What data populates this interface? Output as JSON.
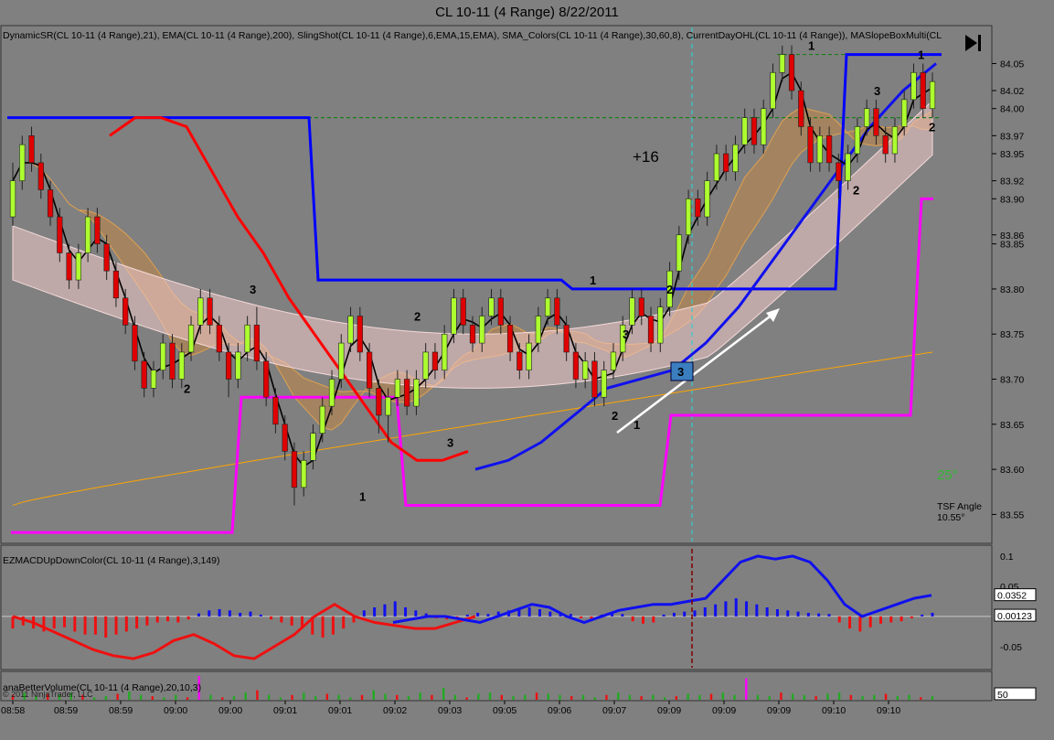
{
  "window": {
    "title": "CL 10-11 (4 Range)  8/22/2011"
  },
  "panels": {
    "price": {
      "indicators_label": "DynamicSR(CL 10-11 (4 Range),21), EMA(CL 10-11 (4 Range),200), SlingShot(CL 10-11 (4 Range),6,EMA,15,EMA), SMA_Colors(CL 10-11 (4 Range),30,60,8), CurrentDayOHL(CL 10-11 (4 Range)), MASlopeBoxMulti(CL",
      "trade_result": "+16",
      "angle_value": "25°",
      "tsf_label": "TSF Angle",
      "tsf_value": "10.55°",
      "box_label": "3"
    },
    "macd": {
      "label": "EZMACDUpDownColor(CL 10-11 (4 Range),3,149)",
      "value1": "0.0352",
      "value2": "0.00123"
    },
    "volume": {
      "label": "anaBetterVolume(CL 10-11 (4 Range),20,10,3)",
      "value": "50",
      "copyright": "© 2011 NinjaTrader, LLC"
    }
  },
  "colors": {
    "background": "#808080",
    "up_bar": "#adff2f",
    "down_bar": "#e00000",
    "ema200": "#ffa500",
    "support_line": "#0000ff",
    "ohl_line": "#ff00ff",
    "slingshot_red": "#ff0000"
  },
  "chart_data": {
    "type": "candlestick",
    "symbol": "CL 10-11 (4 Range)",
    "date": "8/22/2011",
    "ylim": [
      83.52,
      84.09
    ],
    "y_ticks": [
      84.05,
      84.02,
      84.0,
      83.97,
      83.95,
      83.92,
      83.9,
      83.86,
      83.85,
      83.8,
      83.75,
      83.7,
      83.65,
      83.6,
      83.55
    ],
    "x_ticks": [
      "08:58",
      "08:59",
      "08:59",
      "09:00",
      "09:00",
      "09:01",
      "09:01",
      "09:02",
      "09:03",
      "09:05",
      "09:06",
      "09:07",
      "09:09",
      "09:09",
      "09:09",
      "09:10",
      "09:10"
    ],
    "candles": [
      [
        83.88,
        83.92,
        83.94,
        83.87
      ],
      [
        83.92,
        83.96,
        83.97,
        83.91
      ],
      [
        83.97,
        83.94,
        83.98,
        83.93
      ],
      [
        83.94,
        83.91,
        83.95,
        83.9
      ],
      [
        83.91,
        83.88,
        83.92,
        83.87
      ],
      [
        83.88,
        83.84,
        83.89,
        83.83
      ],
      [
        83.84,
        83.81,
        83.85,
        83.8
      ],
      [
        83.81,
        83.84,
        83.85,
        83.8
      ],
      [
        83.84,
        83.88,
        83.89,
        83.83
      ],
      [
        83.88,
        83.85,
        83.89,
        83.84
      ],
      [
        83.85,
        83.82,
        83.86,
        83.81
      ],
      [
        83.82,
        83.79,
        83.83,
        83.78
      ],
      [
        83.79,
        83.76,
        83.8,
        83.75
      ],
      [
        83.76,
        83.72,
        83.77,
        83.71
      ],
      [
        83.72,
        83.69,
        83.73,
        83.68
      ],
      [
        83.69,
        83.71,
        83.72,
        83.68
      ],
      [
        83.71,
        83.74,
        83.75,
        83.7
      ],
      [
        83.74,
        83.7,
        83.75,
        83.69
      ],
      [
        83.7,
        83.73,
        83.74,
        83.69
      ],
      [
        83.73,
        83.76,
        83.77,
        83.72
      ],
      [
        83.76,
        83.79,
        83.8,
        83.75
      ],
      [
        83.79,
        83.76,
        83.8,
        83.75
      ],
      [
        83.76,
        83.73,
        83.77,
        83.72
      ],
      [
        83.73,
        83.7,
        83.74,
        83.68
      ],
      [
        83.7,
        83.73,
        83.74,
        83.69
      ],
      [
        83.73,
        83.76,
        83.77,
        83.72
      ],
      [
        83.76,
        83.72,
        83.78,
        83.71
      ],
      [
        83.72,
        83.68,
        83.73,
        83.67
      ],
      [
        83.68,
        83.65,
        83.69,
        83.64
      ],
      [
        83.65,
        83.62,
        83.66,
        83.61
      ],
      [
        83.62,
        83.58,
        83.63,
        83.56
      ],
      [
        83.58,
        83.61,
        83.62,
        83.57
      ],
      [
        83.61,
        83.64,
        83.65,
        83.6
      ],
      [
        83.64,
        83.67,
        83.68,
        83.63
      ],
      [
        83.67,
        83.7,
        83.71,
        83.66
      ],
      [
        83.7,
        83.74,
        83.75,
        83.69
      ],
      [
        83.74,
        83.77,
        83.78,
        83.73
      ],
      [
        83.77,
        83.73,
        83.78,
        83.72
      ],
      [
        83.73,
        83.69,
        83.74,
        83.68
      ],
      [
        83.69,
        83.66,
        83.7,
        83.64
      ],
      [
        83.66,
        83.68,
        83.69,
        83.63
      ],
      [
        83.68,
        83.7,
        83.71,
        83.67
      ],
      [
        83.7,
        83.67,
        83.71,
        83.66
      ],
      [
        83.67,
        83.7,
        83.71,
        83.66
      ],
      [
        83.7,
        83.73,
        83.74,
        83.69
      ],
      [
        83.73,
        83.71,
        83.74,
        83.7
      ],
      [
        83.71,
        83.75,
        83.76,
        83.7
      ],
      [
        83.75,
        83.79,
        83.8,
        83.74
      ],
      [
        83.79,
        83.76,
        83.8,
        83.75
      ],
      [
        83.76,
        83.74,
        83.77,
        83.73
      ],
      [
        83.74,
        83.77,
        83.78,
        83.73
      ],
      [
        83.77,
        83.79,
        83.8,
        83.76
      ],
      [
        83.79,
        83.76,
        83.8,
        83.75
      ],
      [
        83.76,
        83.73,
        83.77,
        83.72
      ],
      [
        83.73,
        83.71,
        83.74,
        83.7
      ],
      [
        83.71,
        83.74,
        83.75,
        83.7
      ],
      [
        83.74,
        83.77,
        83.78,
        83.73
      ],
      [
        83.77,
        83.79,
        83.8,
        83.76
      ],
      [
        83.79,
        83.76,
        83.8,
        83.75
      ],
      [
        83.76,
        83.73,
        83.77,
        83.72
      ],
      [
        83.73,
        83.7,
        83.74,
        83.69
      ],
      [
        83.7,
        83.72,
        83.73,
        83.69
      ],
      [
        83.72,
        83.68,
        83.73,
        83.67
      ],
      [
        83.68,
        83.71,
        83.72,
        83.67
      ],
      [
        83.71,
        83.73,
        83.74,
        83.7
      ],
      [
        83.73,
        83.76,
        83.77,
        83.72
      ],
      [
        83.76,
        83.79,
        83.8,
        83.75
      ],
      [
        83.79,
        83.77,
        83.8,
        83.76
      ],
      [
        83.77,
        83.74,
        83.78,
        83.73
      ],
      [
        83.74,
        83.78,
        83.79,
        83.73
      ],
      [
        83.78,
        83.82,
        83.83,
        83.77
      ],
      [
        83.82,
        83.86,
        83.87,
        83.81
      ],
      [
        83.86,
        83.9,
        83.91,
        83.85
      ],
      [
        83.9,
        83.88,
        83.91,
        83.87
      ],
      [
        83.88,
        83.92,
        83.93,
        83.87
      ],
      [
        83.92,
        83.95,
        83.96,
        83.91
      ],
      [
        83.95,
        83.93,
        83.96,
        83.92
      ],
      [
        83.93,
        83.96,
        83.97,
        83.92
      ],
      [
        83.96,
        83.99,
        84.0,
        83.95
      ],
      [
        83.99,
        83.96,
        84.0,
        83.95
      ],
      [
        83.96,
        84.0,
        84.01,
        83.95
      ],
      [
        84.0,
        84.04,
        84.05,
        83.99
      ],
      [
        84.04,
        84.06,
        84.07,
        84.03
      ],
      [
        84.06,
        84.02,
        84.07,
        84.01
      ],
      [
        84.02,
        83.98,
        84.03,
        83.97
      ],
      [
        83.98,
        83.94,
        83.99,
        83.93
      ],
      [
        83.94,
        83.97,
        83.98,
        83.93
      ],
      [
        83.97,
        83.94,
        83.98,
        83.93
      ],
      [
        83.94,
        83.92,
        83.95,
        83.9
      ],
      [
        83.92,
        83.95,
        83.96,
        83.91
      ],
      [
        83.95,
        83.98,
        83.99,
        83.94
      ],
      [
        83.98,
        84.0,
        84.01,
        83.97
      ],
      [
        84.0,
        83.97,
        84.01,
        83.96
      ],
      [
        83.97,
        83.95,
        83.98,
        83.94
      ],
      [
        83.95,
        83.98,
        83.99,
        83.94
      ],
      [
        83.98,
        84.01,
        84.02,
        83.97
      ],
      [
        84.01,
        84.04,
        84.05,
        84.0
      ],
      [
        84.04,
        84.0,
        84.05,
        83.99
      ],
      [
        84.0,
        84.03,
        84.04,
        83.99
      ]
    ],
    "candle_fields": [
      "open",
      "close",
      "high",
      "low"
    ],
    "annotations": [
      {
        "text": "1",
        "value": 84.07
      },
      {
        "text": "2",
        "value": 83.69
      },
      {
        "text": "3",
        "value": 83.8
      },
      {
        "text": "2",
        "value": 83.77
      },
      {
        "text": "1",
        "value": 83.57
      },
      {
        "text": "3",
        "value": 83.63
      },
      {
        "text": "1",
        "value": 83.81
      },
      {
        "text": "2",
        "value": 83.8
      },
      {
        "text": "3",
        "value": 83.75
      },
      {
        "text": "2",
        "value": 83.66
      },
      {
        "text": "1",
        "value": 83.65
      },
      {
        "text": "3",
        "value": 84.02
      },
      {
        "text": "2",
        "value": 83.91
      },
      {
        "text": "1",
        "value": 84.06
      },
      {
        "text": "2",
        "value": 83.98
      }
    ],
    "lines": {
      "current_day_high": 84.06,
      "dynamic_sr_start": 83.99,
      "dynamic_sr_mid": 83.81,
      "dynamic_sr_end": 83.8,
      "ohl_low": 83.53,
      "ohl_mid1": 83.68,
      "ohl_mid2": 83.56,
      "ohl_mid3": 83.66,
      "ohl_end": 83.9,
      "prior_level": 83.99
    },
    "macd": {
      "ylim": [
        -0.085,
        0.115
      ],
      "ticks": [
        "0.1",
        "0.05",
        "-0.05"
      ],
      "histogram": [
        -0.02,
        -0.015,
        -0.02,
        -0.025,
        -0.02,
        -0.018,
        -0.025,
        -0.03,
        -0.03,
        -0.035,
        -0.03,
        -0.025,
        -0.02,
        -0.015,
        -0.01,
        -0.008,
        -0.01,
        -0.005,
        0.005,
        0.01,
        0.012,
        0.01,
        0.006,
        0.008,
        0.003,
        -0.005,
        -0.01,
        -0.015,
        -0.02,
        -0.03,
        -0.035,
        -0.03,
        -0.02,
        -0.01,
        0.01,
        0.015,
        0.02,
        0.025,
        0.015,
        0.01,
        0.005,
        -0.003,
        -0.005,
        -0.004,
        0.003,
        0.006,
        0.004,
        0.008,
        0.01,
        0.012,
        0.015,
        0.012,
        0.008,
        0.005,
        0.004,
        -0.003,
        -0.005,
        0.003,
        0.006,
        0.004,
        -0.008,
        -0.012,
        -0.01,
        0.003,
        0.006,
        0.008,
        0.01,
        0.015,
        0.02,
        0.025,
        0.03,
        0.025,
        0.02,
        0.015,
        0.012,
        0.01,
        0.008,
        0.006,
        0.005,
        0.004,
        -0.01,
        -0.02,
        -0.025,
        -0.018,
        -0.012,
        -0.01,
        -0.008,
        -0.003,
        0.003,
        0.006
      ],
      "signal_blue": [
        -0.01,
        -0.005,
        0.0,
        0.0,
        -0.005,
        -0.01,
        0.0,
        0.01,
        0.02,
        0.015,
        0.0,
        -0.01,
        0.0,
        0.01,
        0.015,
        0.02,
        0.02,
        0.025,
        0.03,
        0.06,
        0.09,
        0.1,
        0.095,
        0.1,
        0.09,
        0.06,
        0.02,
        0.0,
        0.01,
        0.02,
        0.03,
        0.035
      ],
      "signal_red": [
        0.0,
        -0.01,
        -0.025,
        -0.04,
        -0.055,
        -0.065,
        -0.07,
        -0.06,
        -0.04,
        -0.03,
        -0.045,
        -0.065,
        -0.07,
        -0.05,
        -0.03,
        0.0,
        0.02,
        0.0,
        -0.01,
        -0.015,
        -0.02,
        -0.02,
        -0.01,
        0.0
      ]
    },
    "volume": {
      "bars": [
        0.2,
        0.3,
        0.15,
        0.25,
        0.2,
        0.3,
        0.2,
        0.1,
        0.15,
        0.25,
        0.35,
        0.2,
        0.15,
        0.1,
        0.2,
        0.1,
        1.0,
        0.2,
        0.1,
        0.15,
        0.3,
        0.4,
        0.2,
        0.1,
        0.2,
        0.3,
        0.15,
        0.25,
        0.2,
        0.1,
        0.2,
        0.4,
        0.25,
        0.2,
        0.15,
        0.3,
        0.2,
        0.5,
        0.2,
        0.1,
        0.25,
        0.3,
        0.2,
        0.15,
        0.2,
        0.3,
        0.25,
        0.2,
        0.15,
        0.2,
        0.1,
        0.2,
        0.3,
        0.2,
        0.15,
        0.2,
        0.1,
        0.15,
        0.25,
        0.2,
        0.25,
        0.3,
        0.2,
        0.9,
        0.2,
        0.15,
        0.3,
        0.25,
        0.2,
        0.15,
        0.25,
        0.3,
        0.2,
        0.15,
        0.2,
        0.25,
        0.15,
        0.2,
        0.1,
        0.15
      ]
    }
  }
}
